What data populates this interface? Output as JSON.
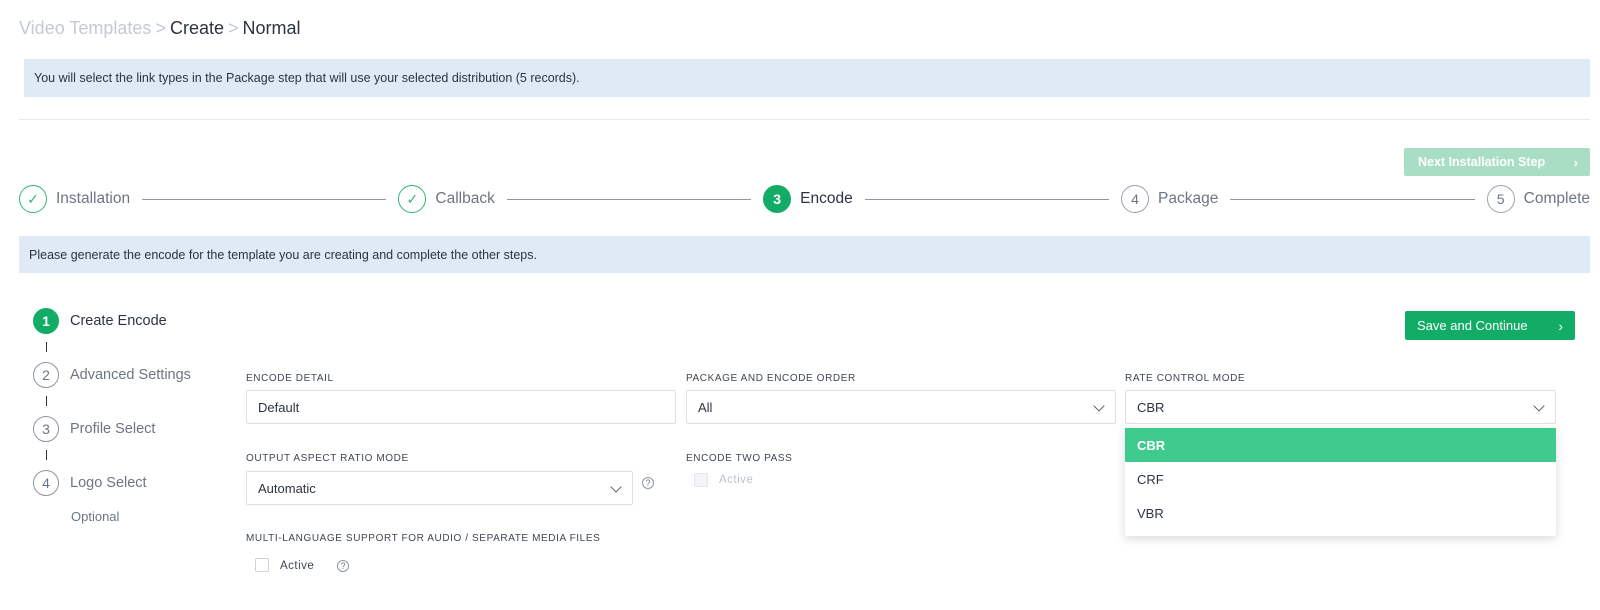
{
  "breadcrumb": {
    "root": "Video Templates",
    "separator": ">",
    "create": "Create",
    "current": "Normal"
  },
  "top_notice": "You will select the link types in the Package step that will use your selected distribution (5 records).",
  "next_step_button": {
    "label": "Next Installation Step",
    "icon": "chevron-right-icon"
  },
  "stepper": {
    "steps": [
      {
        "marker": "✓",
        "label": "Installation",
        "status": "done"
      },
      {
        "marker": "✓",
        "label": "Callback",
        "status": "done"
      },
      {
        "marker": "3",
        "label": "Encode",
        "status": "active"
      },
      {
        "marker": "4",
        "label": "Package",
        "status": "pending"
      },
      {
        "marker": "5",
        "label": "Complete",
        "status": "pending"
      }
    ]
  },
  "encode_notice": "Please generate the encode for the template you are creating and complete the other steps.",
  "substeps": {
    "items": [
      {
        "number": "1",
        "label": "Create Encode",
        "status": "active"
      },
      {
        "number": "2",
        "label": "Advanced Settings",
        "status": "pending"
      },
      {
        "number": "3",
        "label": "Profile Select",
        "status": "pending"
      },
      {
        "number": "4",
        "label": "Logo Select",
        "status": "pending"
      }
    ],
    "optional_note": "Optional"
  },
  "save_button": {
    "label": "Save and Continue",
    "icon": "chevron-right-icon"
  },
  "form": {
    "encode_detail": {
      "label": "ENCODE DETAIL",
      "value": "Default"
    },
    "package_order": {
      "label": "PACKAGE AND ENCODE ORDER",
      "value": "All"
    },
    "rate_control": {
      "label": "RATE CONTROL MODE",
      "value": "CBR",
      "options": [
        "CBR",
        "CRF",
        "VBR"
      ],
      "open": true
    },
    "aspect_ratio": {
      "label": "OUTPUT ASPECT RATIO MODE",
      "value": "Automatic",
      "help": "?"
    },
    "two_pass": {
      "label": "ENCODE TWO PASS",
      "checkbox_label": "Active",
      "checked": false,
      "disabled": true
    },
    "multi_language": {
      "label": "MULTI-LANGUAGE SUPPORT FOR AUDIO / SEPARATE MEDIA FILES",
      "checkbox_label": "Active",
      "checked": false,
      "help": "?"
    }
  },
  "colors": {
    "accent": "#13ac66",
    "accent_light": "#3ecb8d",
    "disabled_button": "#a9dec4",
    "notice_bg": "#dfeaf5"
  }
}
